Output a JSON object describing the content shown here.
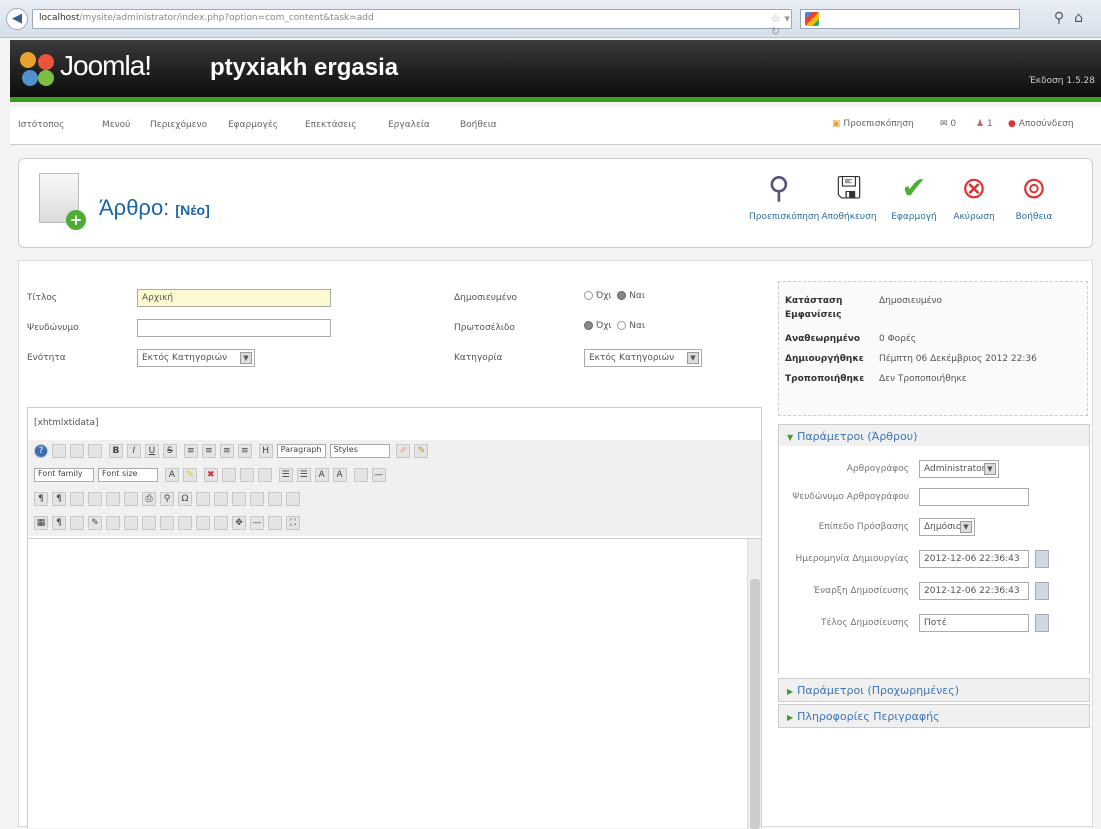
{
  "browser": {
    "url_host": "localhost",
    "url_path": "/mysite/administrator/index.php?option=com_content&task=add"
  },
  "header": {
    "brand": "Joomla!",
    "site_name": "ptyxiakh ergasia",
    "version": "Έκδοση 1.5.28"
  },
  "menu": [
    "Ιστότοπος",
    "Μενού",
    "Περιεχόμενο",
    "Εφαρμογές",
    "Επεκτάσεις",
    "Εργαλεία",
    "Βοήθεια"
  ],
  "status": {
    "preview": "Προεπισκόπηση",
    "count1": "0",
    "count2": "1",
    "logout": "Αποσύνδεση"
  },
  "page": {
    "title": "Άρθρο:",
    "subtitle": "[Νέο]"
  },
  "toolbar": [
    "Προεπισκόπηση",
    "Αποθήκευση",
    "Εφαρμογή",
    "Ακύρωση",
    "Βοήθεια"
  ],
  "form": {
    "title_label": "Τίτλος",
    "title_value": "Αρχική",
    "alias_label": "Ψευδώνυμο",
    "alias_value": "",
    "section_label": "Ενότητα",
    "section_value": "Εκτός Κατηγοριών",
    "published_label": "Δημοσιευμένο",
    "frontpage_label": "Πρωτοσέλιδο",
    "no": "Όχι",
    "yes": "Ναι",
    "category_label": "Κατηγορία",
    "category_value": "Εκτός Κατηγοριών"
  },
  "editor": {
    "label": "[xhtmlxtidata]",
    "paragraph": "Paragraph",
    "styles": "Styles",
    "font_family": "Font family",
    "font_size": "Font size"
  },
  "info": {
    "state_label": "Κατάσταση",
    "state_value": "Δημοσιευμένο",
    "workflow_label": "Εμφανίσεις",
    "revised_label": "Αναθεωρημένο",
    "revised_value": "0 Φορές",
    "created_label": "Δημιουργήθηκε",
    "created_value": "Πέμπτη 06 Δεκέμβριος 2012 22:36",
    "modified_label": "Τροποποιήθηκε",
    "modified_value": "Δεν Τροποποιήθηκε"
  },
  "params": {
    "heading": "Παράμετροι (Άρθρου)",
    "author_label": "Αρθρογράφος",
    "author_value": "Administrator",
    "alias_label": "Ψευδώνυμο Αρθρογράφου",
    "access_label": "Επίπεδο Πρόσβασης",
    "access_value": "Δημόσιο",
    "created_label": "Ημερομηνία Δημιουργίας",
    "created_value": "2012-12-06 22:36:43",
    "start_label": "Έναρξη Δημοσίευσης",
    "start_value": "2012-12-06 22:36:43",
    "end_label": "Τέλος Δημοσίευσης",
    "end_value": "Ποτέ"
  },
  "accordions": [
    "Παράμετροι (Προχωρημένες)",
    "Πληροφορίες Περιγραφής"
  ]
}
